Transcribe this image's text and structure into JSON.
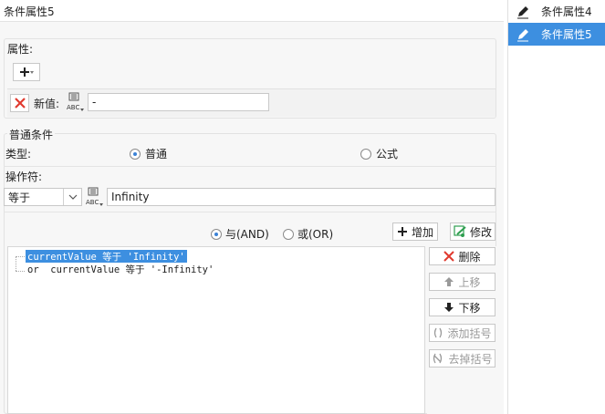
{
  "editor": {
    "title": "条件属性5"
  },
  "attributes": {
    "label": "属性:",
    "new_value_label": "新值:",
    "new_value": "-"
  },
  "condition": {
    "label": "普通条件",
    "type_label": "类型:",
    "type_options": [
      "普通",
      "公式"
    ],
    "type_selected": "普通",
    "operator_label": "操作符:",
    "operator_value": "等于",
    "operand_value": "Infinity",
    "logic_options": [
      "与(AND)",
      "或(OR)"
    ],
    "logic_selected": "与(AND)",
    "add_label": "增加",
    "modify_label": "修改"
  },
  "expressions": [
    {
      "text": "currentValue 等于 'Infinity'",
      "selected": true
    },
    {
      "text": "or  currentValue 等于 '-Infinity'",
      "selected": false
    }
  ],
  "actions": {
    "delete": "删除",
    "move_up": "上移",
    "move_down": "下移",
    "add_bracket": "添加括号",
    "remove_bracket": "去掉括号"
  },
  "side_list": {
    "items": [
      {
        "label": "条件属性4",
        "selected": false
      },
      {
        "label": "条件属性5",
        "selected": true
      }
    ]
  },
  "colors": {
    "accent": "#3d8fe0",
    "delete_red": "#e03a2f",
    "modify_green": "#2e9e4f"
  }
}
